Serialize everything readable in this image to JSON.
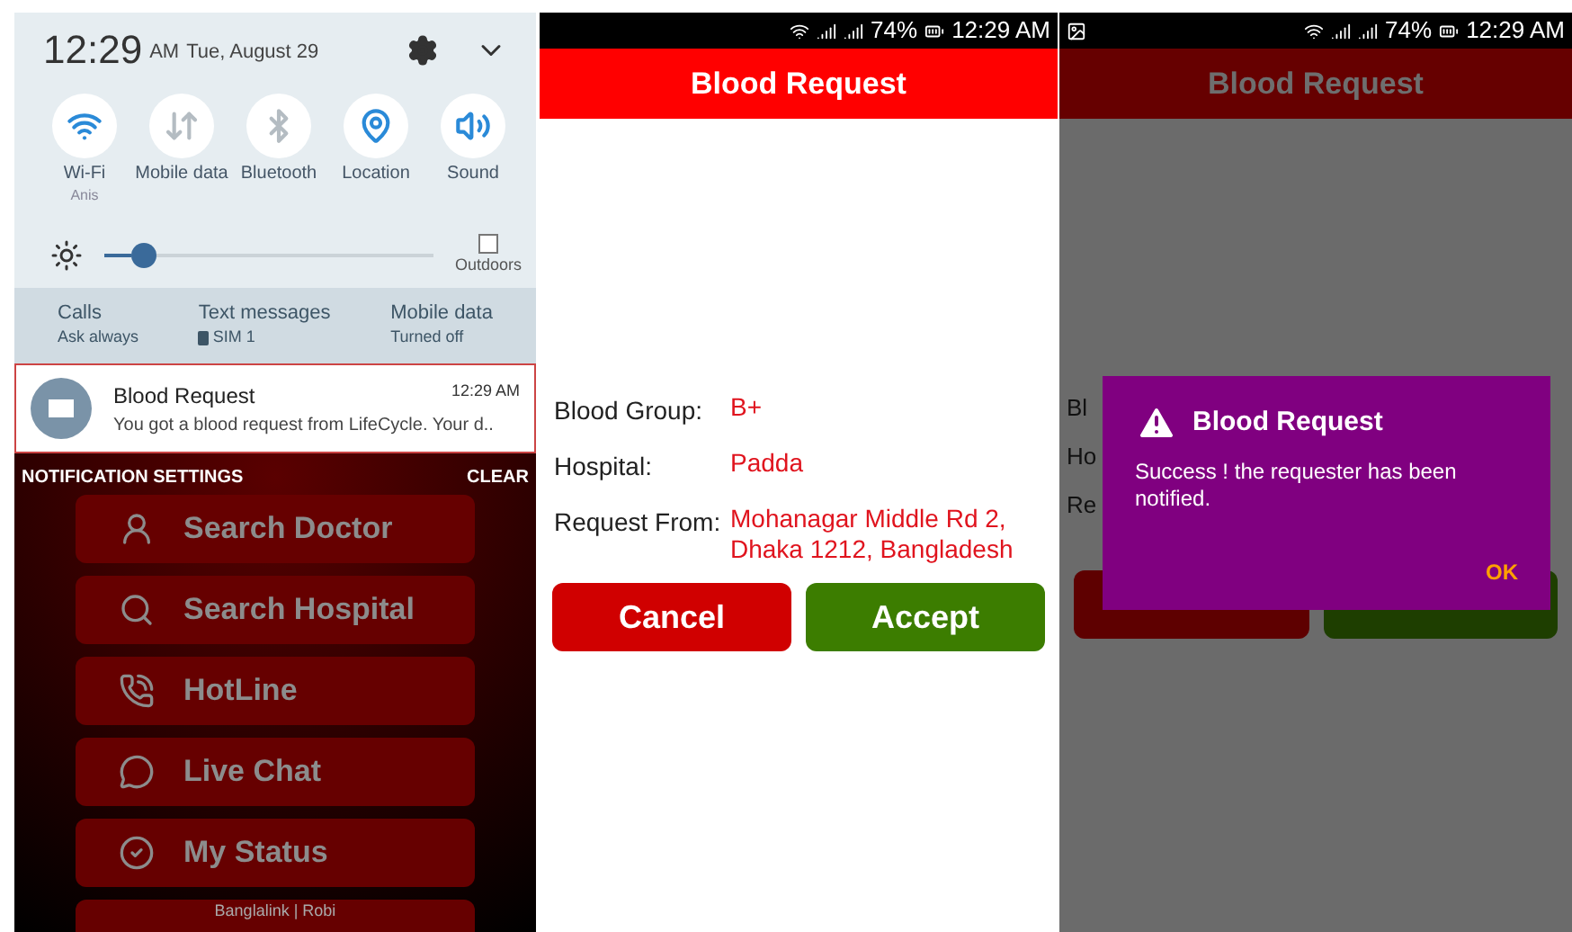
{
  "notification_shade": {
    "time": "12:29",
    "am_pm": "AM",
    "date": "Tue, August 29",
    "toggles": [
      {
        "kind": "wifi",
        "label": "Wi-Fi",
        "sublabel": "Anis",
        "on": true
      },
      {
        "kind": "data",
        "label": "Mobile data",
        "on": false
      },
      {
        "kind": "bluetooth",
        "label": "Bluetooth",
        "on": false
      },
      {
        "kind": "location",
        "label": "Location",
        "on": true
      },
      {
        "kind": "sound",
        "label": "Sound",
        "on": true
      }
    ],
    "brightness": {
      "level": 0.08
    },
    "outdoors": {
      "label": "Outdoors",
      "checked": false
    },
    "sim_settings": [
      {
        "kind": "plain",
        "title": "Calls",
        "value": "Ask always"
      },
      {
        "kind": "sim",
        "title": "Text messages",
        "value": "SIM 1"
      },
      {
        "kind": "plain",
        "title": "Mobile data",
        "value": "Turned off"
      }
    ],
    "notification": {
      "title": "Blood Request",
      "time": "12:29 AM",
      "text": "You got a blood request from LifeCycle. Your d.."
    },
    "actions": [
      "NOTIFICATION SETTINGS",
      "CLEAR"
    ]
  },
  "app_menu": [
    {
      "kind": "doctor",
      "label": "Search Doctor"
    },
    {
      "kind": "search",
      "label": "Search Hospital"
    },
    {
      "kind": "hotline",
      "label": "HotLine"
    },
    {
      "kind": "chat",
      "label": "Live Chat"
    },
    {
      "kind": "status",
      "label": "My Status"
    },
    {
      "kind": "partial",
      "label": "Banglalink | Robi"
    }
  ],
  "request_screen": {
    "status_bar": {
      "battery": "74%",
      "time": "12:29 AM"
    },
    "title": "Blood Request",
    "fields": [
      {
        "label": "Blood Group:",
        "value": "B+"
      },
      {
        "label": "Hospital:",
        "value": "Padda"
      },
      {
        "label": "Request From:",
        "value": "Mohanagar Middle Rd 2, Dhaka 1212, Bangladesh"
      }
    ],
    "buttons": [
      {
        "kind": "cancel",
        "label": "Cancel"
      },
      {
        "kind": "accept",
        "label": "Accept"
      }
    ]
  },
  "dialog_screen": {
    "status_bar": {
      "battery": "74%",
      "time": "12:29 AM"
    },
    "title": "Blood Request",
    "labels_visible": [
      "Bl",
      "Ho",
      "Re"
    ],
    "buttons": [
      {
        "kind": "cancel"
      },
      {
        "kind": "accept"
      }
    ],
    "dialog": {
      "title": "Blood Request",
      "message": "Success ! the requester has been notified.",
      "button": "OK"
    }
  }
}
